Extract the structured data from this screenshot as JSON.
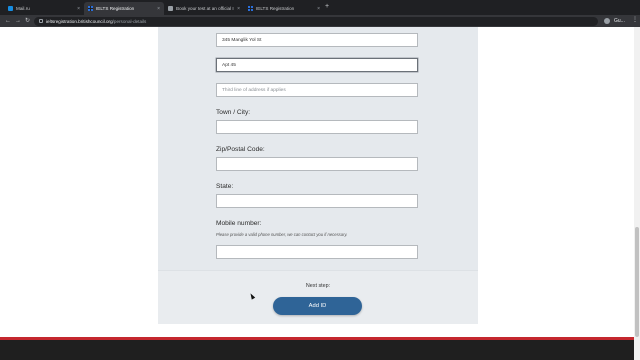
{
  "browser": {
    "tabs": [
      {
        "title": "Mail.ru",
        "close": "×"
      },
      {
        "title": "IELTS Registration",
        "close": "×"
      },
      {
        "title": "Book your test at an official IE...",
        "close": "×"
      },
      {
        "title": "IELTS Registration",
        "close": "×"
      }
    ],
    "new_tab": "+",
    "back": "←",
    "forward": "→",
    "reload": "↻",
    "url_host": "ieltsregistration.britishcouncil.org",
    "url_path": "/personal-details",
    "profile_name": "Gu...",
    "menu": "⋮"
  },
  "form": {
    "address_line_1": "345 Manglik Yol St",
    "address_line_2": "Apt 45",
    "address_line_3_placeholder": "Third line of address if applies",
    "town_label": "Town / City:",
    "town_value": "",
    "zip_label": "Zip/Postal Code:",
    "zip_value": "",
    "state_label": "State:",
    "state_value": "",
    "mobile_label": "Mobile number:",
    "mobile_hint": "Please provide a valid phone number, we can contact you if necessary.",
    "mobile_value": ""
  },
  "next": {
    "label": "Next step:",
    "button": "Add ID"
  },
  "colors": {
    "button": "#2f6497",
    "footer_stripe": "#c4282f",
    "card": "#e5e9ed"
  }
}
